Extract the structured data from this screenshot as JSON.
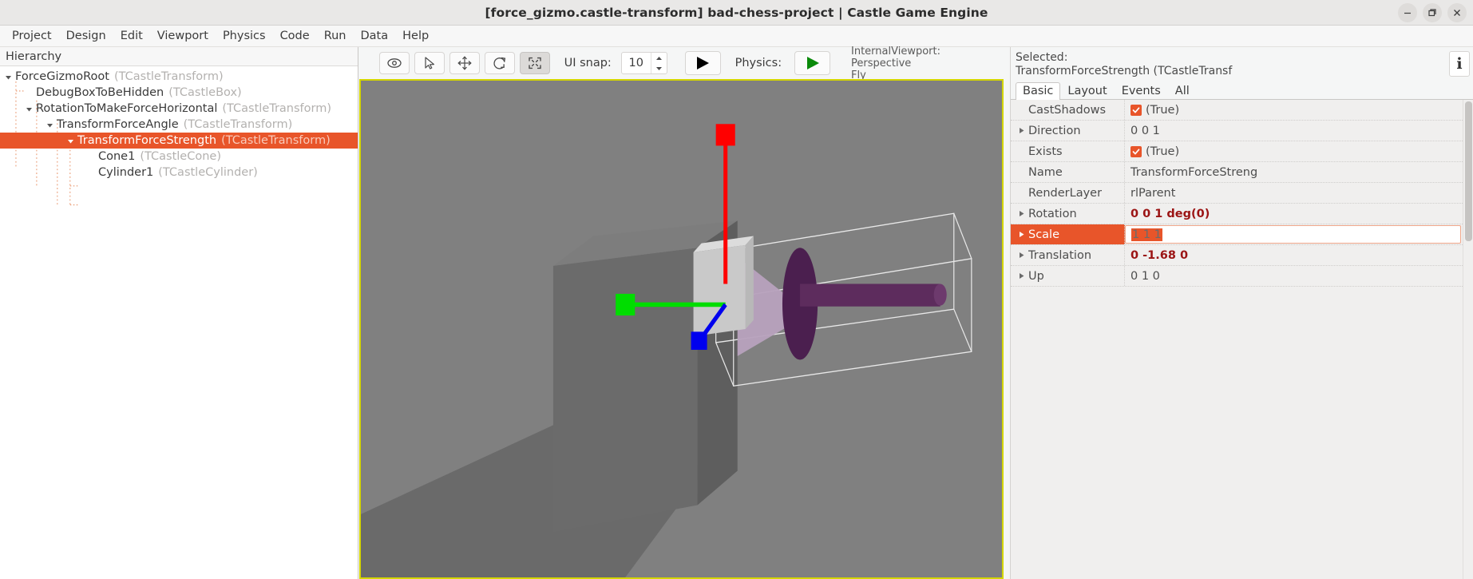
{
  "window": {
    "title": "[force_gizmo.castle-transform] bad-chess-project | Castle Game Engine",
    "controls": [
      {
        "name": "minimize",
        "glyph": "minimize-icon"
      },
      {
        "name": "maximize",
        "glyph": "maximize-icon"
      },
      {
        "name": "close",
        "glyph": "close-icon"
      }
    ]
  },
  "menubar": {
    "items": [
      {
        "label": "Project"
      },
      {
        "label": "Design"
      },
      {
        "label": "Edit"
      },
      {
        "label": "Viewport"
      },
      {
        "label": "Physics"
      },
      {
        "label": "Code"
      },
      {
        "label": "Run"
      },
      {
        "label": "Data"
      },
      {
        "label": "Help"
      }
    ]
  },
  "hierarchy": {
    "header": "Hierarchy",
    "nodes": [
      {
        "name": "ForceGizmoRoot",
        "class": "(TCastleTransform)",
        "depth": 0,
        "expanded": true,
        "selected": false
      },
      {
        "name": "DebugBoxToBeHidden",
        "class": "(TCastleBox)",
        "depth": 1,
        "expanded": null,
        "selected": false
      },
      {
        "name": "RotationToMakeForceHorizontal",
        "class": "(TCastleTransform)",
        "depth": 1,
        "expanded": true,
        "selected": false
      },
      {
        "name": "TransformForceAngle",
        "class": "(TCastleTransform)",
        "depth": 2,
        "expanded": true,
        "selected": false
      },
      {
        "name": "TransformForceStrength",
        "class": "(TCastleTransform)",
        "depth": 3,
        "expanded": true,
        "selected": true
      },
      {
        "name": "Cone1",
        "class": "(TCastleCone)",
        "depth": 4,
        "expanded": null,
        "selected": false
      },
      {
        "name": "Cylinder1",
        "class": "(TCastleCylinder)",
        "depth": 4,
        "expanded": null,
        "selected": false
      }
    ]
  },
  "toolbar": {
    "buttons": [
      {
        "name": "toggle-visibility-button",
        "icon": "eye-icon",
        "active": false
      },
      {
        "name": "select-tool-button",
        "icon": "cursor-arrow-icon",
        "active": false
      },
      {
        "name": "translate-tool-button",
        "icon": "move-arrows-icon",
        "active": false
      },
      {
        "name": "rotate-tool-button",
        "icon": "rotate-arrow-icon",
        "active": false
      },
      {
        "name": "scale-tool-button",
        "icon": "scale-corners-icon",
        "active": true
      }
    ],
    "ui_snap_label": "UI snap:",
    "ui_snap_value": "10",
    "run_icon": "play-triangle-icon",
    "physics_label": "Physics:",
    "physics_icon": "play-triangle-green-icon",
    "viewport_info": "InternalViewport: Perspective\nFly"
  },
  "viewport": {
    "border_color": "#d4d600",
    "background_color": "#808080",
    "gizmo": {
      "x_axis_color": "#ff0000",
      "y_axis_color": "#00cc00",
      "z_axis_color": "#0000ee"
    },
    "objects": [
      {
        "name": "debug-box",
        "color": "#6e6e6e"
      },
      {
        "name": "force-cone",
        "color": "#a186a8"
      },
      {
        "name": "force-cylinder",
        "color": "#5d2c5d"
      },
      {
        "name": "selection-wireframe",
        "color": "#e6e6e6"
      }
    ]
  },
  "inspector": {
    "selected_label": "Selected:\nTransformForceStrength (TCastleTransf",
    "info_button": "i",
    "tabs": [
      {
        "label": "Basic",
        "active": true
      },
      {
        "label": "Layout",
        "active": false
      },
      {
        "label": "Events",
        "active": false
      },
      {
        "label": "All",
        "active": false
      }
    ],
    "properties": [
      {
        "name": "CastShadows",
        "value": "(True)",
        "type": "bool",
        "checked": true,
        "expandable": false,
        "selected": false,
        "accent": false,
        "editing": false
      },
      {
        "name": "Direction",
        "value": "0 0 1",
        "type": "text",
        "expandable": true,
        "selected": false,
        "accent": false,
        "editing": false
      },
      {
        "name": "Exists",
        "value": "(True)",
        "type": "bool",
        "checked": true,
        "expandable": false,
        "selected": false,
        "accent": false,
        "editing": false
      },
      {
        "name": "Name",
        "value": "TransformForceStreng",
        "type": "text",
        "expandable": false,
        "selected": false,
        "accent": false,
        "editing": false
      },
      {
        "name": "RenderLayer",
        "value": "rlParent",
        "type": "text",
        "expandable": false,
        "selected": false,
        "accent": false,
        "editing": false
      },
      {
        "name": "Rotation",
        "value": "0 0 1 deg(0)",
        "type": "text",
        "expandable": true,
        "selected": false,
        "accent": true,
        "editing": false
      },
      {
        "name": "Scale",
        "value": "1 1 1",
        "type": "text",
        "expandable": true,
        "selected": true,
        "accent": false,
        "editing": true
      },
      {
        "name": "Translation",
        "value": "0 -1.68 0",
        "type": "text",
        "expandable": true,
        "selected": false,
        "accent": true,
        "editing": false
      },
      {
        "name": "Up",
        "value": "0 1 0",
        "type": "text",
        "expandable": true,
        "selected": false,
        "accent": false,
        "editing": false
      }
    ]
  },
  "colors": {
    "accent_orange": "#e8552a",
    "value_red": "#9b1414",
    "viewport_border": "#d4d600"
  }
}
